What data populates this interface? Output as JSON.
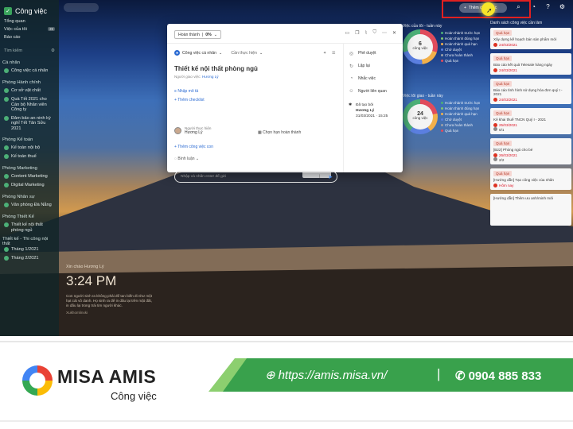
{
  "app": {
    "title": "Công việc",
    "logo_glyph": "✓"
  },
  "sidebar": {
    "top_items": [
      {
        "label": "Tổng quan"
      },
      {
        "label": "Việc của tôi",
        "badge": "39"
      },
      {
        "label": "Báo cáo"
      }
    ],
    "search_placeholder": "Tìm kiếm",
    "sections": [
      {
        "title": "Cá nhân",
        "items": [
          "Công việc cá nhân"
        ]
      },
      {
        "title": "Phòng Hành chính",
        "items": [
          "Cơ sở vật chất",
          "Quà Tết 2021 cho Cán bộ Nhân viên Công ty",
          "Đảm bảo an ninh kỳ nghỉ Tết Tân Sửu 2021"
        ]
      },
      {
        "title": "Phòng Kế toán",
        "items": [
          "Kế toán nội bộ",
          "Kế toán thuế"
        ]
      },
      {
        "title": "Phòng Marketing",
        "items": [
          "Content Marketing",
          "Digital Marketing"
        ]
      },
      {
        "title": "Phòng Nhân sự",
        "items": [
          "Văn phòng Đà Nẵng"
        ]
      },
      {
        "title": "Phòng Thiết Kế",
        "items": [
          "Thiết kế nội thất phòng ngủ"
        ]
      },
      {
        "title": "Thiết kế - Thi công nội thất",
        "items": [
          "Tháng 1/2021",
          "Tháng 2/2021"
        ]
      }
    ]
  },
  "topbar": {
    "add_label": "Thêm công việc"
  },
  "widgets": [
    {
      "title": "Việc của tôi - tuần này",
      "total": "6",
      "unit": "công việc",
      "legend": [
        "Hoàn thành trước hạn",
        "Hoàn thành đúng hạn",
        "Hoàn thành quá hạn",
        "Chờ duyệt",
        "Chưa hoàn thành",
        "Quá hạn"
      ]
    },
    {
      "title": "Việc tôi giao - tuần này",
      "total": "24",
      "unit": "công việc",
      "legend": [
        "Hoàn thành trước hạn",
        "Hoàn thành đúng hạn",
        "Hoàn thành quá hạn",
        "Chờ duyệt",
        "Chưa hoàn thành",
        "Quá hạn"
      ]
    }
  ],
  "colors": {
    "red_tag": "#f6d7d3",
    "accent_blue": "#2a6ad2",
    "brand_green": "#39a14c"
  },
  "right_column": {
    "title": "Danh sách công việc cần làm",
    "cards": [
      {
        "tag": "Quá hạn",
        "text": "Xây dựng kế hoạch bán sản phẩm mới",
        "date": "24/03/2021"
      },
      {
        "tag": "Quá hạn",
        "text": "Báo cáo kết quả Telesale hàng ngày",
        "date": "24/03/2021"
      },
      {
        "tag": "Quá hạn",
        "text": "Báo cáo tình hình sử dụng hóa đơn quý I - 2021",
        "date": "24/03/2021"
      },
      {
        "tag": "Quá hạn",
        "text": "Kê khai thuế TNCN Quý I - 2021",
        "date": "25/03/2021",
        "meta": "0/1"
      },
      {
        "tag": "Quá hạn",
        "text": "[B22] Phòng ngủ cho bé",
        "date": "26/03/2021",
        "meta": "2/2"
      },
      {
        "tag": "Quá hạn",
        "text": "[Hướng dẫn] Tạo công việc của nhân",
        "date": "Hôm nay"
      },
      {
        "tag": "",
        "text": "[Hướng dẫn] Thêm ưu anh/minh mới",
        "date": ""
      }
    ]
  },
  "greeting": {
    "hello": "Xin chào Hương Lý",
    "time": "3:24 PM",
    "quote": "Con người sinh ra không phải để tan biến đi như một hạt cát vô danh. Họ sinh ra để in dấu lại trên mặt đất, in dấu lại trong trái tim người khác.",
    "author": "Xukhomlinxki"
  },
  "modal": {
    "status": "Hoàn thành",
    "percent": "0%",
    "project": "Công việc cá nhân",
    "group": "Cần thực hiện",
    "task_title": "Thiết kế nội thất phòng ngủ",
    "assigner_label": "Người giao việc:",
    "assigner_name": "Hương Lý",
    "add_description": "Nhập mô tả",
    "add_checklist": "Thêm checklist",
    "assignee_label": "Người thực hiện",
    "assignee_name": "Hương Lý",
    "deadline_label": "Chọn hạn hoàn thành",
    "add_subtask": "Thêm công việc con",
    "comments_label": "Bình luận",
    "comment_placeholder": "Nhập và nhấn enter để gửi",
    "side_actions": [
      "Phê duyệt",
      "Lặp lại",
      "Nhắc việc",
      "Người liên quan"
    ],
    "created_label": "Đã tạo bởi",
    "created_by": "Hương Lý",
    "created_at": "31/03/2021 · 15:25"
  },
  "footer": {
    "brand": "MISA AMIS",
    "product": "Công việc",
    "url": "https://amis.misa.vn/",
    "separator": "|",
    "phone": "0904 885 833"
  }
}
